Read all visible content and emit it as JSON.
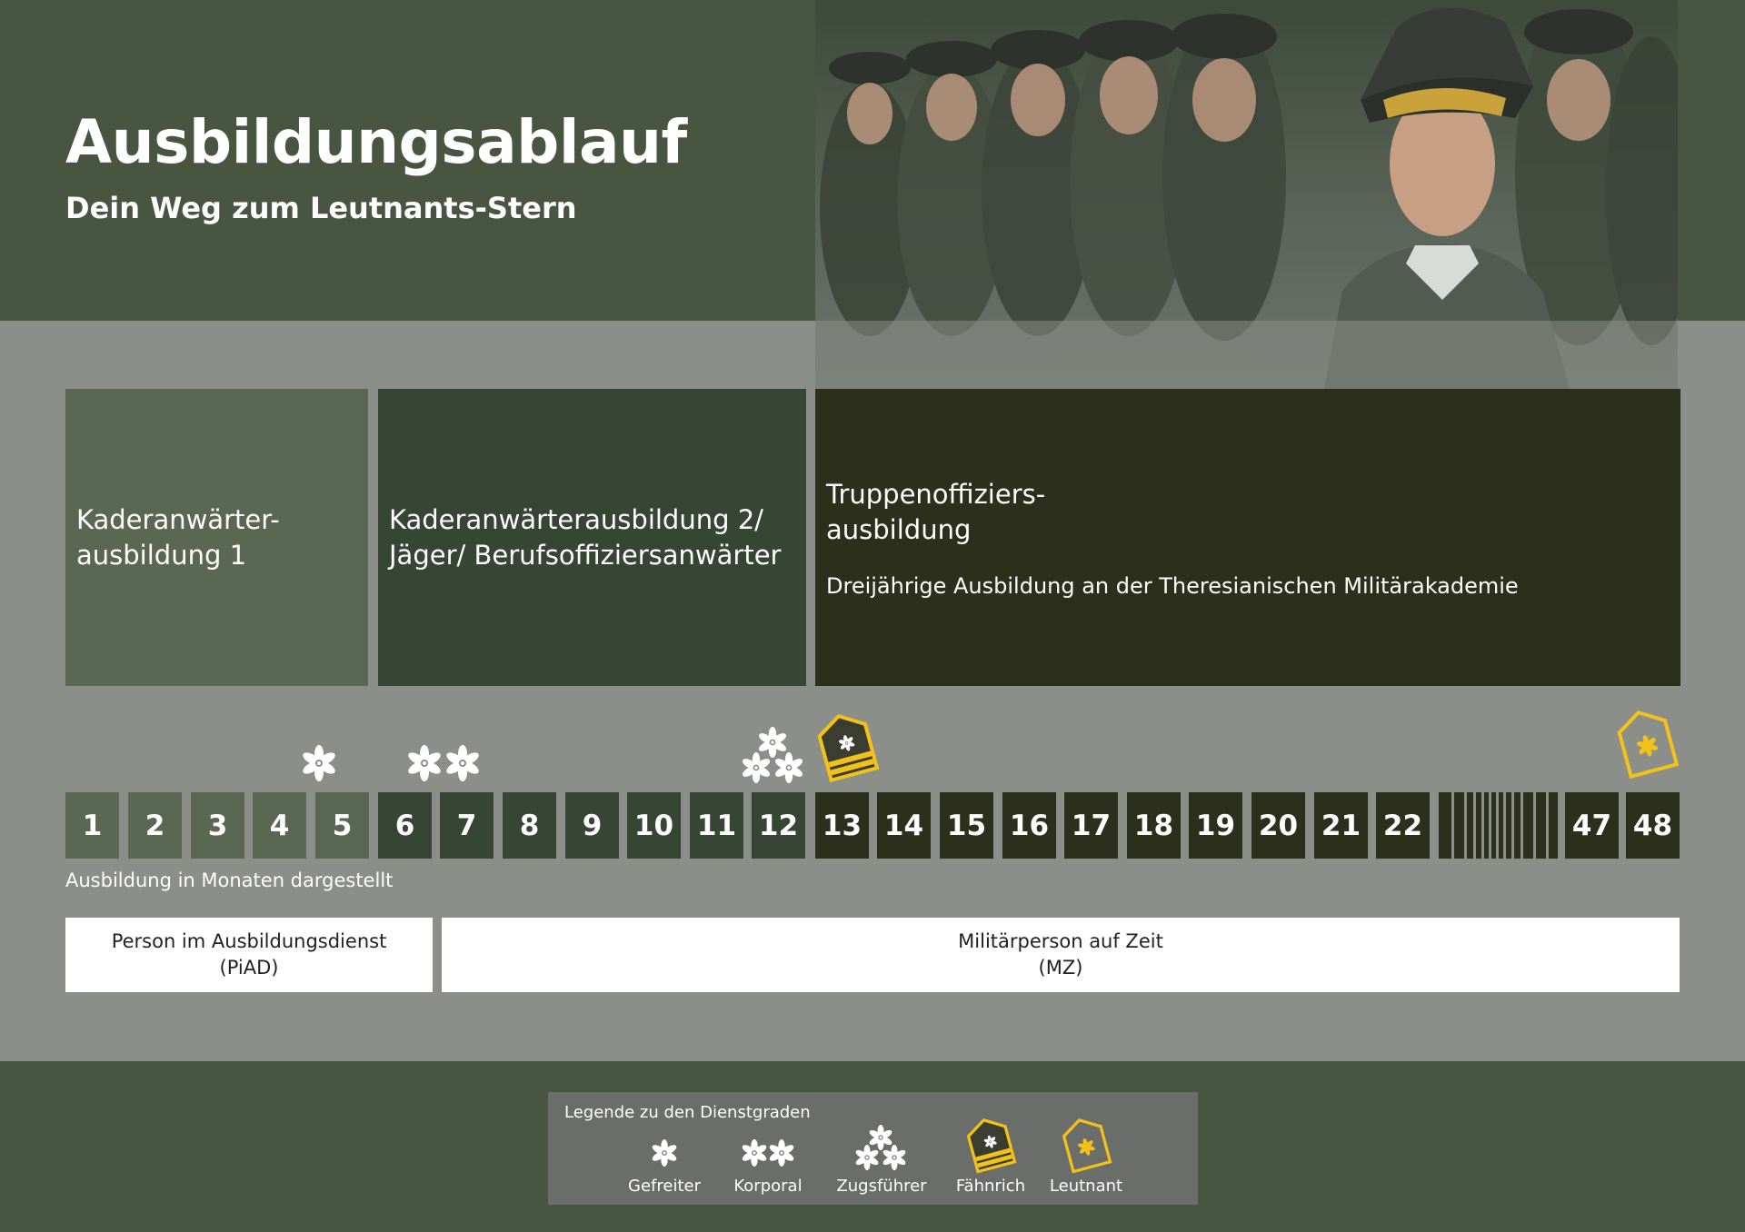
{
  "header": {
    "title": "Ausbildungsablauf",
    "subtitle": "Dein Weg zum Leutnants-Stern"
  },
  "photo": {
    "icon": "soldiers-photo"
  },
  "phases": [
    {
      "title": "Kaderanwärter-\nausbildung 1",
      "subtitle": ""
    },
    {
      "title": "Kaderanwärterausbildung 2/\nJäger/ Berufsoffiziersanwärter",
      "subtitle": ""
    },
    {
      "title": "Truppenoffiziers-\nausbildung",
      "subtitle": "Dreijährige Ausbildung an der Theresianischen Militärakademie"
    }
  ],
  "months": [
    "1",
    "2",
    "3",
    "4",
    "5",
    "6",
    "7",
    "8",
    "9",
    "10",
    "11",
    "12",
    "13",
    "14",
    "15",
    "16",
    "17",
    "18",
    "19",
    "20",
    "21",
    "22",
    "47",
    "48"
  ],
  "months_note": "Ausbildung in Monaten dargestellt",
  "status": {
    "piad": {
      "line1": "Person im Ausbildungsdienst",
      "line2": "(PiAD)"
    },
    "mz": {
      "line1": "Militärperson auf Zeit",
      "line2": "(MZ)"
    }
  },
  "legend": {
    "title": "Legende zu den Dienstgraden",
    "items": [
      {
        "label": "Gefreiter",
        "icon": "one-star-icon"
      },
      {
        "label": "Korporal",
        "icon": "two-stars-icon"
      },
      {
        "label": "Zugsführer",
        "icon": "three-stars-icon"
      },
      {
        "label": "Fähnrich",
        "icon": "faehnrich-epaulette-icon"
      },
      {
        "label": "Leutnant",
        "icon": "leutnant-epaulette-icon"
      }
    ]
  },
  "colors": {
    "band": "#485541",
    "background": "#8b8e89",
    "phase1": "#5a6753",
    "phase2": "#374535",
    "phase3": "#2c2f1c",
    "gold": "#f2c21b"
  }
}
